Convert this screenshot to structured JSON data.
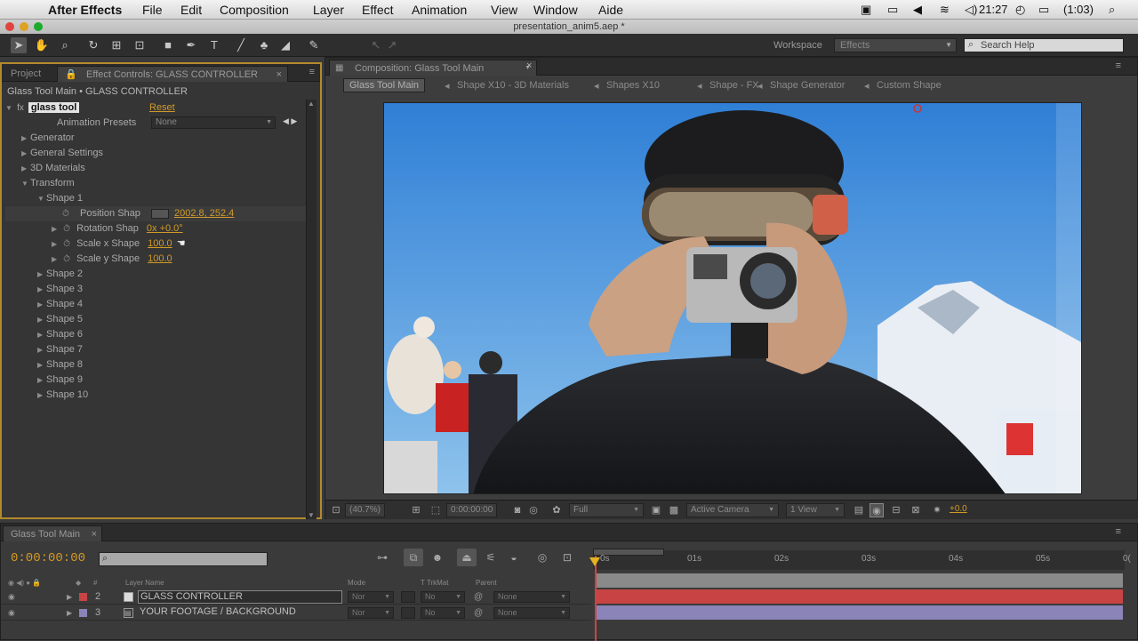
{
  "menubar": {
    "app": "After Effects",
    "items": [
      "File",
      "Edit",
      "Composition",
      "Layer",
      "Effect",
      "Animation",
      "View",
      "Window",
      "Aide"
    ],
    "clock": "21:27",
    "battery": "(1:03)"
  },
  "window": {
    "title": "presentation_anim5.aep *"
  },
  "toolbar": {
    "workspace_label": "Workspace",
    "workspace_value": "Effects",
    "search_placeholder": "Search Help"
  },
  "effect_panel": {
    "tabs": [
      "Project",
      "Effect Controls: GLASS CONTROLLER"
    ],
    "breadcrumb": "Glass Tool Main • GLASS CONTROLLER",
    "effect_name": "glass tool",
    "reset_label": "Reset",
    "presets_label": "Animation Presets",
    "presets_value": "None",
    "groups": [
      "Generator",
      "General Settings",
      "3D Materials",
      "Transform"
    ],
    "shape1": "Shape 1",
    "props": [
      {
        "label": "Position Shap",
        "value": "2002.8, 252.4"
      },
      {
        "label": "Rotation Shap",
        "value": "0x +0.0°"
      },
      {
        "label": "Scale x Shape",
        "value": "100.0"
      },
      {
        "label": "Scale y Shape",
        "value": "100.0"
      }
    ],
    "shapes": [
      "Shape 2",
      "Shape 3",
      "Shape 4",
      "Shape 5",
      "Shape 6",
      "Shape 7",
      "Shape 8",
      "Shape 9",
      "Shape 10"
    ]
  },
  "comp_panel": {
    "tab": "Composition: Glass Tool Main",
    "flow": [
      "Glass Tool Main",
      "Shape X10 - 3D Materials",
      "Shapes X10",
      "Shape - FX",
      "Shape Generator",
      "Custom Shape"
    ],
    "footer": {
      "zoom": "(40.7%)",
      "timecode": "0:00:00:00",
      "resolution": "Full",
      "camera": "Active Camera",
      "views": "1 View",
      "exposure": "+0.0"
    }
  },
  "timeline": {
    "tab": "Glass Tool Main",
    "timecode": "0:00:00:00",
    "columns": {
      "layer_name": "Layer Name",
      "mode": "Mode",
      "trkmat": "T TrkMat",
      "parent": "Parent"
    },
    "layers": [
      {
        "num": "2",
        "name": "GLASS CONTROLLER",
        "mode": "Nor",
        "trkmat": "No",
        "parent": "None",
        "color": "#c84444"
      },
      {
        "num": "3",
        "name": "YOUR FOOTAGE / BACKGROUND",
        "mode": "Nor",
        "trkmat": "No",
        "parent": "None",
        "color": "#8a84b8"
      }
    ],
    "ruler": [
      "0s",
      "01s",
      "02s",
      "03s",
      "04s",
      "05s",
      "0("
    ]
  }
}
